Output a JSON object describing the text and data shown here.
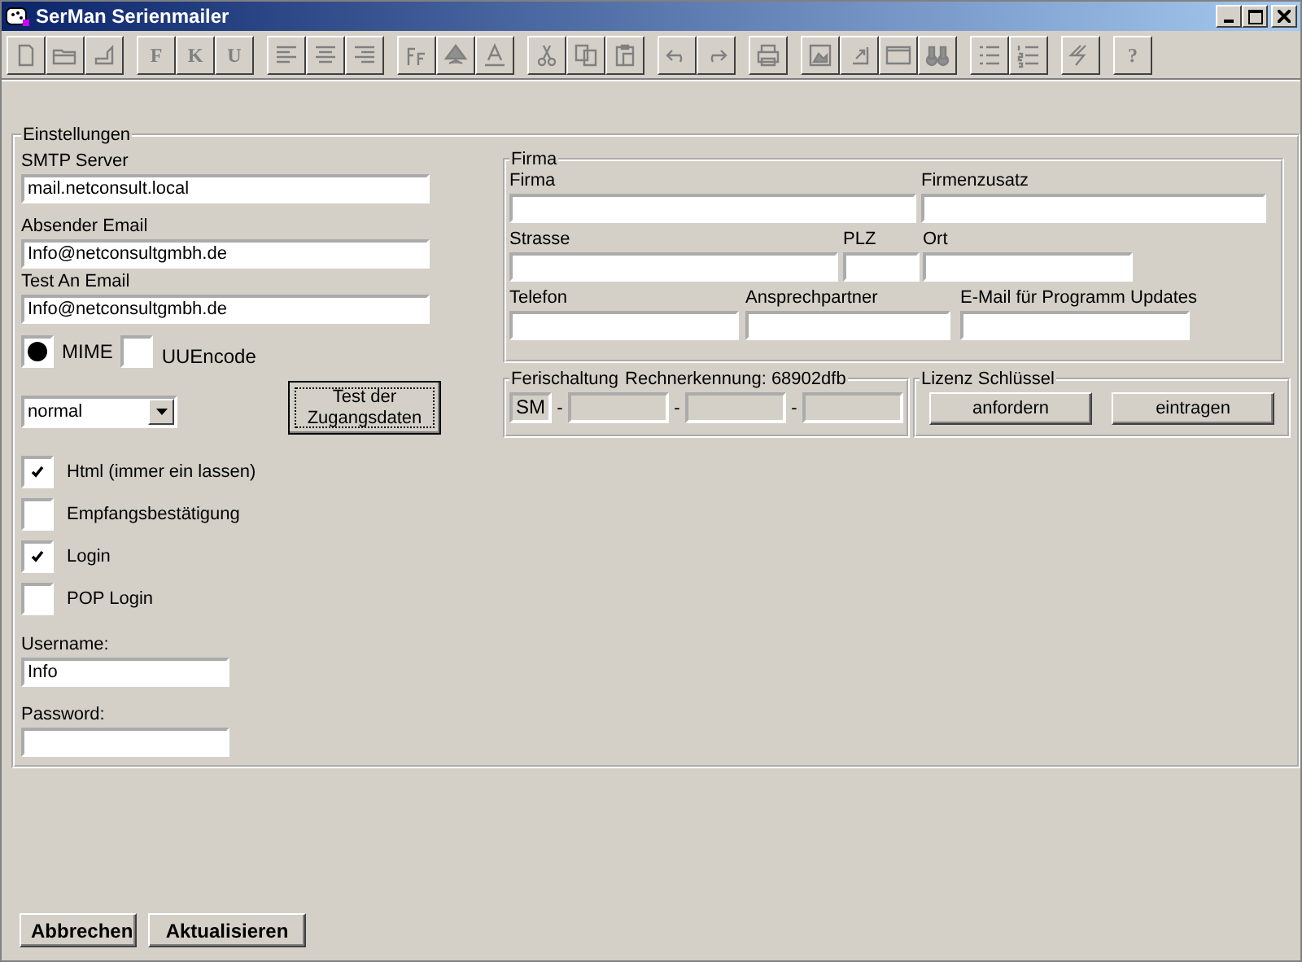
{
  "window": {
    "title": "SerMan Serienmailer"
  },
  "toolbar": [
    [
      {
        "kind": "icon"
      },
      {
        "kind": "icon"
      },
      {
        "kind": "icon"
      }
    ],
    [
      {
        "kind": "text",
        "label": "F"
      },
      {
        "kind": "text",
        "label": "K"
      },
      {
        "kind": "text",
        "label": "U"
      }
    ],
    [
      {
        "kind": "icon"
      },
      {
        "kind": "icon"
      },
      {
        "kind": "icon"
      }
    ],
    [
      {
        "kind": "icon"
      },
      {
        "kind": "icon"
      },
      {
        "kind": "icon"
      }
    ],
    [
      {
        "kind": "icon"
      },
      {
        "kind": "icon"
      },
      {
        "kind": "icon"
      }
    ],
    [
      {
        "kind": "icon"
      },
      {
        "kind": "icon"
      }
    ],
    [
      {
        "kind": "icon"
      }
    ],
    [
      {
        "kind": "icon"
      },
      {
        "kind": "icon"
      },
      {
        "kind": "icon"
      },
      {
        "kind": "icon"
      }
    ],
    [
      {
        "kind": "icon"
      },
      {
        "kind": "icon"
      }
    ],
    [
      {
        "kind": "icon"
      }
    ],
    [
      {
        "kind": "text",
        "label": "?"
      }
    ]
  ],
  "settings": {
    "title": "Einstellungen",
    "fields": [
      {
        "label": "SMTP Server",
        "value": "mail.netconsult.local"
      },
      {
        "label": "Absender Email",
        "value": "Info@netconsultgmbh.de"
      },
      {
        "label": "Test An Email",
        "value": "Info@netconsultgmbh.de"
      }
    ],
    "encoding": [
      {
        "label": "MIME",
        "selected": true
      },
      {
        "label": "UUEncode",
        "selected": false
      }
    ],
    "priority": {
      "value": "normal"
    },
    "test_button": "Test der Zugangsdaten",
    "checkboxes": [
      {
        "label": "Html (immer ein lassen)",
        "checked": true
      },
      {
        "label": "Empfangsbestätigung",
        "checked": false
      },
      {
        "label": "Login",
        "checked": true
      },
      {
        "label": "POP Login",
        "checked": false
      }
    ],
    "username": {
      "label": "Username:",
      "value": "Info"
    },
    "password": {
      "label": "Password:"
    }
  },
  "firma": {
    "title": "Firma",
    "fields": [
      {
        "label": "Firma"
      },
      {
        "label": "Firmenzusatz"
      },
      {
        "label": "Strasse"
      },
      {
        "label": "PLZ"
      },
      {
        "label": "Ort"
      },
      {
        "label": "Telefon"
      },
      {
        "label": "Ansprechpartner"
      },
      {
        "label": "E-Mail für Programm Updates"
      }
    ]
  },
  "activation": {
    "title": "Ferischaltung",
    "machine_id": "Rechnerkennung: 68902dfb",
    "prefix": "SM",
    "separators": [
      "-",
      "-",
      "-"
    ]
  },
  "license": {
    "title": "Lizenz Schlüssel",
    "buttons": [
      "anfordern",
      "eintragen"
    ]
  },
  "buttons": [
    "Abbrechen",
    "Aktualisieren"
  ]
}
